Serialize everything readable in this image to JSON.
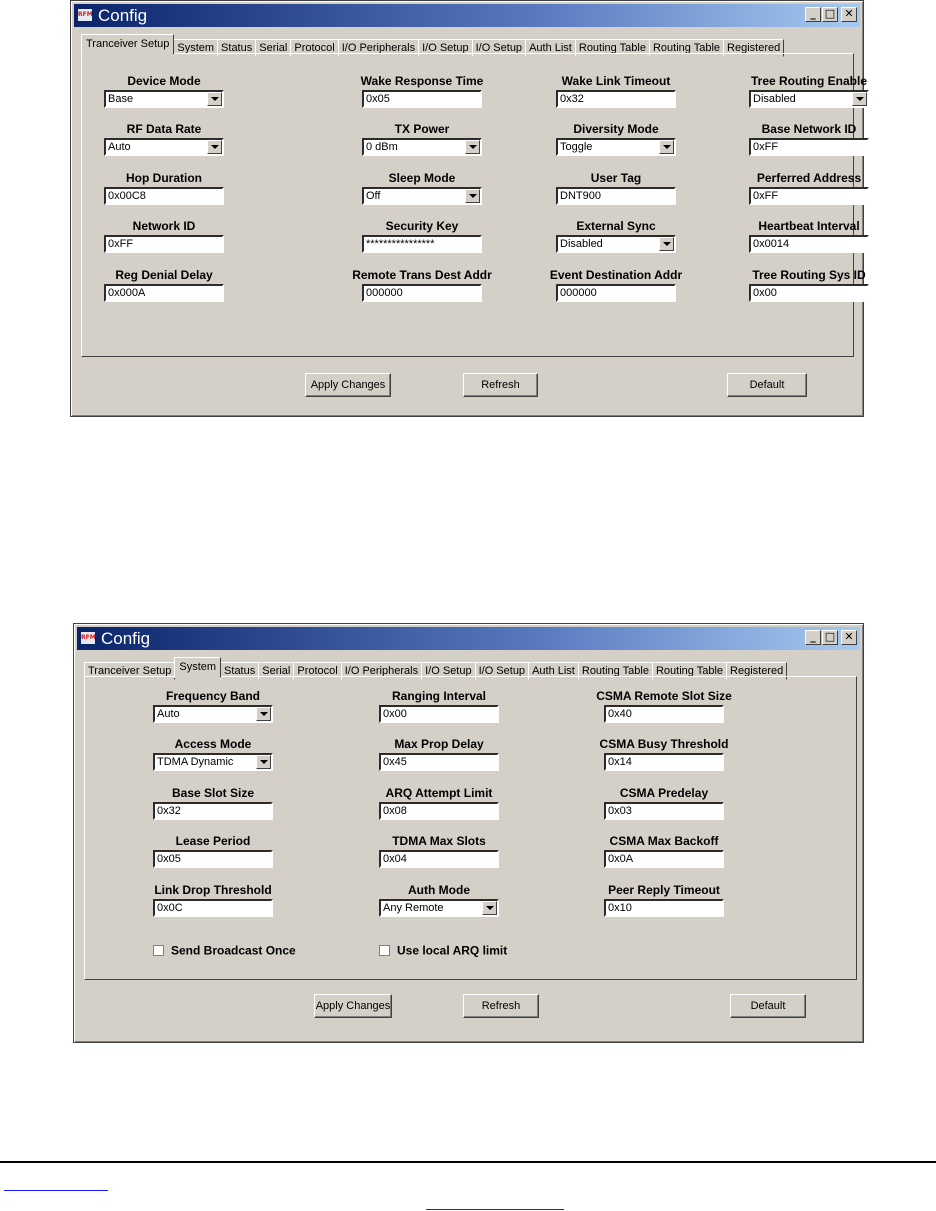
{
  "window1": {
    "icon_text": "RFM",
    "title": "Config",
    "controls": {
      "minimize": "_",
      "maximize": "□",
      "close": "✕"
    },
    "tabs": [
      "Tranceiver Setup",
      "System",
      "Status",
      "Serial",
      "Protocol",
      "I/O Peripherals",
      "I/O Setup",
      "I/O Setup",
      "Auth List",
      "Routing Table",
      "Routing Table",
      "Registered"
    ],
    "active_tab": 0,
    "fields": [
      {
        "label": "Device Mode",
        "value": "Base",
        "type": "dropdown"
      },
      {
        "label": "Wake Response Time",
        "value": "0x05",
        "type": "text"
      },
      {
        "label": "Wake Link Timeout",
        "value": "0x32",
        "type": "text"
      },
      {
        "label": "Tree Routing Enable",
        "value": "Disabled",
        "type": "dropdown"
      },
      {
        "label": "RF Data Rate",
        "value": "Auto",
        "type": "dropdown"
      },
      {
        "label": "TX Power",
        "value": "0 dBm",
        "type": "dropdown"
      },
      {
        "label": "Diversity Mode",
        "value": "Toggle",
        "type": "dropdown"
      },
      {
        "label": "Base Network ID",
        "value": "0xFF",
        "type": "text"
      },
      {
        "label": "Hop Duration",
        "value": "0x00C8",
        "type": "text"
      },
      {
        "label": "Sleep Mode",
        "value": "Off",
        "type": "dropdown"
      },
      {
        "label": "User Tag",
        "value": "DNT900",
        "type": "text"
      },
      {
        "label": "Perferred Address",
        "value": "0xFF",
        "type": "text"
      },
      {
        "label": "Network ID",
        "value": "0xFF",
        "type": "text"
      },
      {
        "label": "Security Key",
        "value": "****************",
        "type": "text"
      },
      {
        "label": "External Sync",
        "value": "Disabled",
        "type": "dropdown"
      },
      {
        "label": "Heartbeat Interval",
        "value": "0x0014",
        "type": "text"
      },
      {
        "label": "Reg Denial Delay",
        "value": "0x000A",
        "type": "text"
      },
      {
        "label": "Remote Trans Dest Addr",
        "value": "000000",
        "type": "text"
      },
      {
        "label": "Event Destination Addr",
        "value": "000000",
        "type": "text"
      },
      {
        "label": "Tree Routing Sys ID",
        "value": "0x00",
        "type": "text"
      }
    ],
    "buttons": {
      "apply": "Apply Changes",
      "refresh": "Refresh",
      "default": "Default"
    }
  },
  "window2": {
    "icon_text": "RFM",
    "title": "Config",
    "controls": {
      "minimize": "_",
      "maximize": "□",
      "close": "✕"
    },
    "tabs": [
      "Tranceiver Setup",
      "System",
      "Status",
      "Serial",
      "Protocol",
      "I/O Peripherals",
      "I/O Setup",
      "I/O Setup",
      "Auth List",
      "Routing Table",
      "Routing Table",
      "Registered"
    ],
    "active_tab": 1,
    "fields": [
      {
        "label": "Frequency Band",
        "value": "Auto",
        "type": "dropdown"
      },
      {
        "label": "Ranging Interval",
        "value": "0x00",
        "type": "text"
      },
      {
        "label": "CSMA Remote Slot Size",
        "value": "0x40",
        "type": "text"
      },
      {
        "label": "Access Mode",
        "value": "TDMA Dynamic",
        "type": "dropdown"
      },
      {
        "label": "Max Prop Delay",
        "value": "0x45",
        "type": "text"
      },
      {
        "label": "CSMA Busy Threshold",
        "value": "0x14",
        "type": "text"
      },
      {
        "label": "Base Slot Size",
        "value": "0x32",
        "type": "text"
      },
      {
        "label": "ARQ Attempt Limit",
        "value": "0x08",
        "type": "text"
      },
      {
        "label": "CSMA Predelay",
        "value": "0x03",
        "type": "text"
      },
      {
        "label": "Lease Period",
        "value": "0x05",
        "type": "text"
      },
      {
        "label": "TDMA Max Slots",
        "value": "0x04",
        "type": "text"
      },
      {
        "label": "CSMA Max Backoff",
        "value": "0x0A",
        "type": "text"
      },
      {
        "label": "Link Drop Threshold",
        "value": "0x0C",
        "type": "text"
      },
      {
        "label": "Auth Mode",
        "value": "Any Remote",
        "type": "dropdown"
      },
      {
        "label": "Peer Reply Timeout",
        "value": "0x10",
        "type": "text"
      }
    ],
    "checkboxes": [
      {
        "label": "Send Broadcast Once",
        "checked": false
      },
      {
        "label": "Use local ARQ limit",
        "checked": false
      }
    ],
    "buttons": {
      "apply": "Apply Changes",
      "refresh": "Refresh",
      "default": "Default"
    }
  }
}
